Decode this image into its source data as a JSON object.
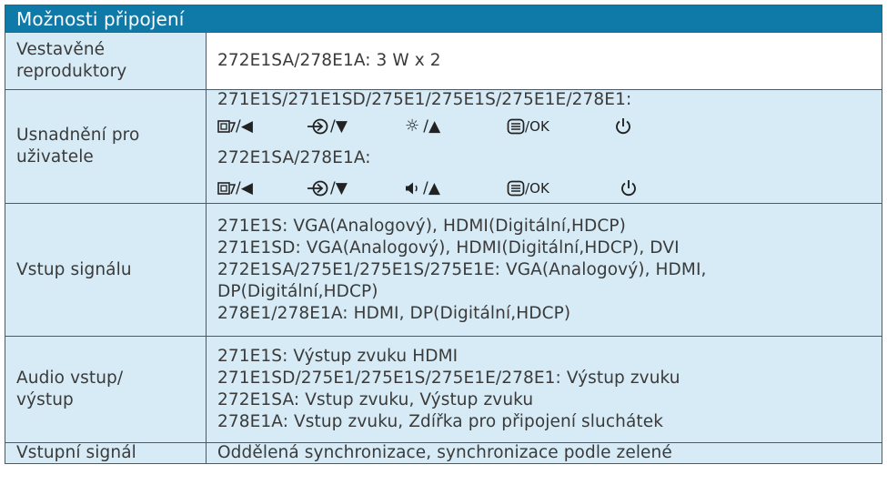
{
  "header": "Možnosti připojení",
  "rows": {
    "speakers": {
      "label_l1": "Vestavěné",
      "label_l2": "reproduktory",
      "value": "272E1SA/278E1A: 3 W x 2"
    },
    "usability": {
      "label_l1": "Usnadnění pro",
      "label_l2": "uživatele",
      "model_line_1": "271E1S/271E1SD/275E1/275E1S/275E1E/278E1:",
      "model_line_2": "272E1SA/278E1A:",
      "controls_1": {
        "c1": "/◀",
        "c2": "/▼",
        "c3": "/▲",
        "c4": "/OK"
      },
      "controls_2": {
        "c1": "/◀",
        "c2": "/▼",
        "c3": "/▲",
        "c4": "/OK"
      },
      "icons_1": [
        "smartimage-icon",
        "input-icon",
        "brightness-icon",
        "menu-icon",
        "power-icon"
      ],
      "icons_2": [
        "smartimage-icon",
        "input-icon",
        "volume-icon",
        "menu-icon",
        "power-icon"
      ]
    },
    "signal_input": {
      "label": "Vstup signálu",
      "lines": [
        "271E1S: VGA(Analogový), HDMI(Digitální,HDCP)",
        "271E1SD: VGA(Analogový), HDMI(Digitální,HDCP), DVI",
        "272E1SA/275E1/275E1S/275E1E: VGA(Analogový), HDMI,",
        "DP(Digitální,HDCP)",
        "278E1/278E1A: HDMI, DP(Digitální,HDCP)"
      ]
    },
    "audio": {
      "label_l1": "Audio vstup/",
      "label_l2": "výstup",
      "lines": [
        "271E1S: Výstup zvuku HDMI",
        "271E1SD/275E1/275E1S/275E1E/278E1: Výstup zvuku",
        "272E1SA: Vstup zvuku, Výstup zvuku",
        "278E1A: Vstup zvuku, Zdířka pro připojení sluchátek"
      ]
    },
    "input_signal": {
      "label": "Vstupní signál",
      "value": "Oddělená synchronizace, synchronizace podle zelené"
    }
  }
}
